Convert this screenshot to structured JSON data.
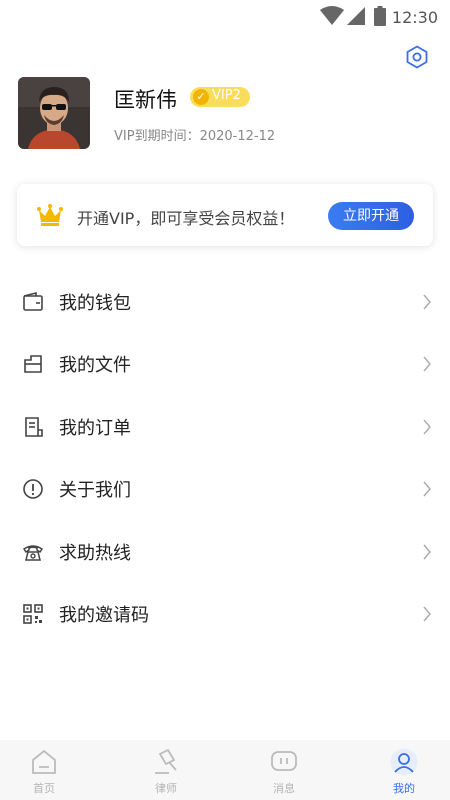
{
  "status_bar": {
    "time": "12:30"
  },
  "profile": {
    "name": "匡新伟",
    "vip_level": "VIP2",
    "expire_text": "VIP到期时间：2020-12-12"
  },
  "vip_card": {
    "promo_text": "开通VIP，即可享受会员权益！",
    "button_label": "立即开通"
  },
  "menu": [
    {
      "label": "我的钱包",
      "icon": "wallet-icon"
    },
    {
      "label": "我的文件",
      "icon": "file-icon"
    },
    {
      "label": "我的订单",
      "icon": "order-icon"
    },
    {
      "label": "关于我们",
      "icon": "info-icon"
    },
    {
      "label": "求助热线",
      "icon": "phone-icon"
    },
    {
      "label": "我的邀请码",
      "icon": "qrcode-icon"
    }
  ],
  "tabs": [
    {
      "label": "首页",
      "icon": "home-icon"
    },
    {
      "label": "律师",
      "icon": "gavel-icon"
    },
    {
      "label": "消息",
      "icon": "message-icon"
    },
    {
      "label": "我的",
      "icon": "user-icon"
    }
  ],
  "colors": {
    "accent": "#3a6fe8",
    "vip_gold": "#f9dd5a"
  }
}
